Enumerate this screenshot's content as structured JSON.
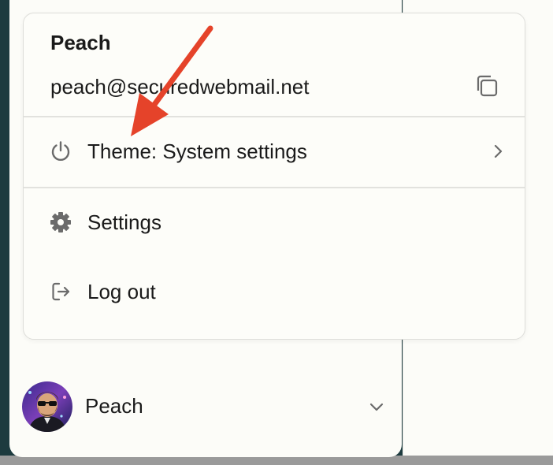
{
  "user_menu": {
    "name": "Peach",
    "email": "peach@securedwebmail.net",
    "copy_icon": "copy-icon",
    "items": [
      {
        "id": "theme",
        "label": "Theme: System settings",
        "icon": "power-icon",
        "has_submenu": true
      },
      {
        "id": "settings",
        "label": "Settings",
        "icon": "gear-icon"
      },
      {
        "id": "logout",
        "label": "Log out",
        "icon": "logout-icon"
      }
    ]
  },
  "account": {
    "name": "Peach",
    "icon": "chevron-down-icon"
  },
  "colors": {
    "annotation_arrow": "#e5432a",
    "background": "#fcfcf8",
    "border": "#dededa",
    "icon_gray": "#6b6b6b"
  }
}
